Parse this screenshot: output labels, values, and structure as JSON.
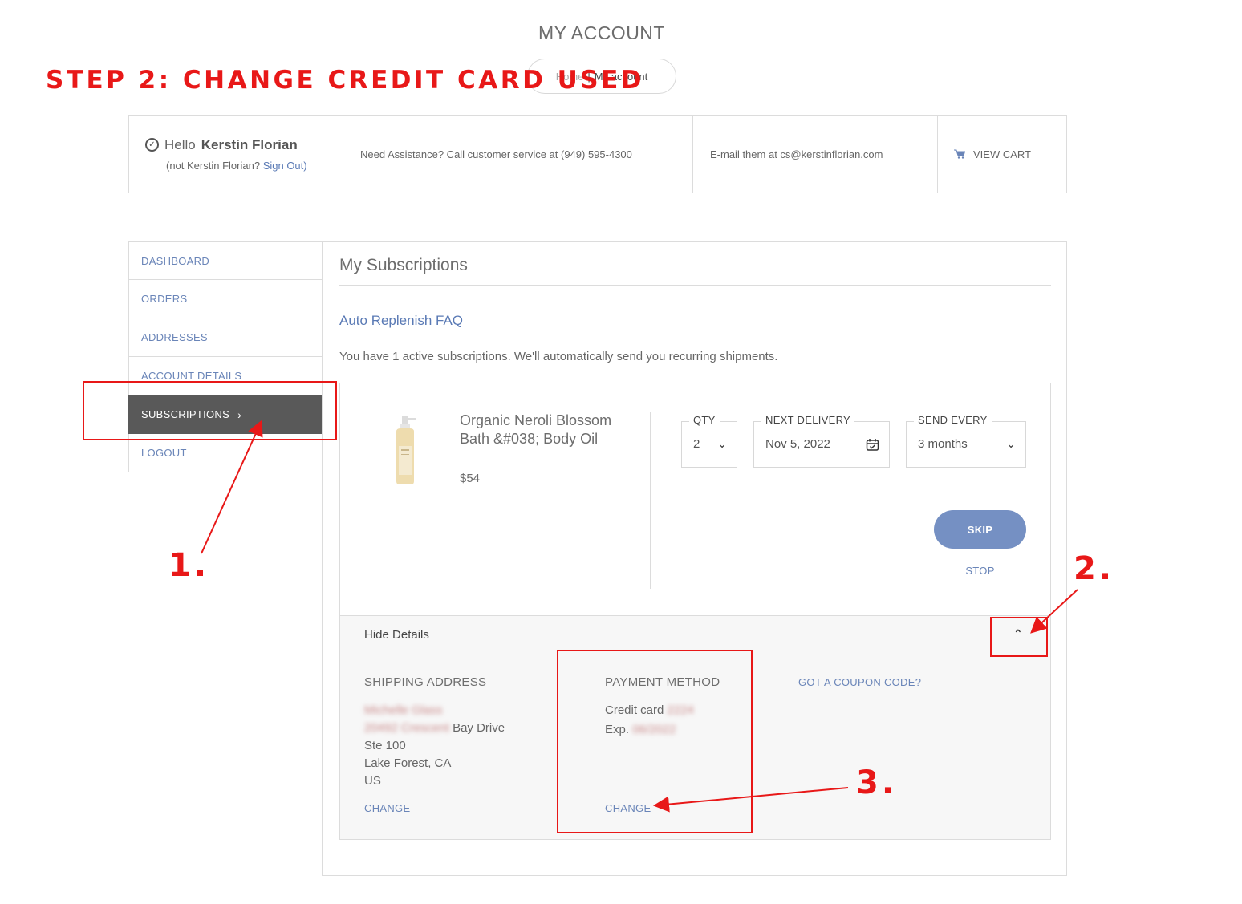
{
  "page": {
    "title": "MY ACCOUNT"
  },
  "breadcrumb": {
    "home": "Home",
    "separator": "|",
    "current": "My account"
  },
  "annotation": {
    "heading": "STEP 2: CHANGE CREDIT CARD USED",
    "step1": "1.",
    "step2": "2.",
    "step3": "3.",
    "color": "#e81818"
  },
  "account_bar": {
    "hello_prefix": "Hello",
    "user_name": "Kerstin Florian",
    "not_user_text": "(not Kerstin Florian?",
    "sign_out": "Sign Out)",
    "assistance": "Need Assistance? Call customer service at (949) 595-4300",
    "email": "E-mail them at cs@kerstinflorian.com",
    "view_cart": "VIEW CART",
    "icons": {
      "hello": "check-circle-icon",
      "cart": "cart-icon"
    }
  },
  "sidebar": {
    "items": [
      {
        "label": "DASHBOARD",
        "active": false
      },
      {
        "label": "ORDERS",
        "active": false
      },
      {
        "label": "ADDRESSES",
        "active": false
      },
      {
        "label": "ACCOUNT DETAILS",
        "active": false
      },
      {
        "label": "SUBSCRIPTIONS",
        "active": true
      },
      {
        "label": "LOGOUT",
        "active": false
      }
    ]
  },
  "main": {
    "title": "My Subscriptions",
    "faq_link": "Auto Replenish FAQ",
    "active_text": "You have 1 active subscriptions. We'll automatically send you recurring shipments."
  },
  "subscription": {
    "product_name": "Organic Neroli Blossom Bath &#038; Body Oil",
    "price": "$54",
    "qty": {
      "label": "QTY",
      "value": "2"
    },
    "next_delivery": {
      "label": "NEXT DELIVERY",
      "value": "Nov 5, 2022"
    },
    "send_every": {
      "label": "SEND EVERY",
      "value": "3 months"
    },
    "skip": "SKIP",
    "stop": "STOP"
  },
  "details": {
    "toggle_label": "Hide Details",
    "shipping": {
      "heading": "SHIPPING ADDRESS",
      "name_blurred": "Michelle Glass",
      "street_blurred": "20492 Crescent",
      "street_rest": "Bay Drive",
      "line2": "Ste 100",
      "city": "Lake Forest, CA",
      "country": "US",
      "change": "CHANGE"
    },
    "payment": {
      "heading": "PAYMENT METHOD",
      "card_prefix": "Credit card",
      "card_blurred": "2224",
      "exp_prefix": "Exp.",
      "exp_blurred": "06/2022",
      "change": "CHANGE"
    },
    "coupon": "GOT A COUPON CODE?"
  },
  "colors": {
    "accent_link": "#6a85b8",
    "active_sidebar": "#595959",
    "skip_button": "#7590c3"
  }
}
